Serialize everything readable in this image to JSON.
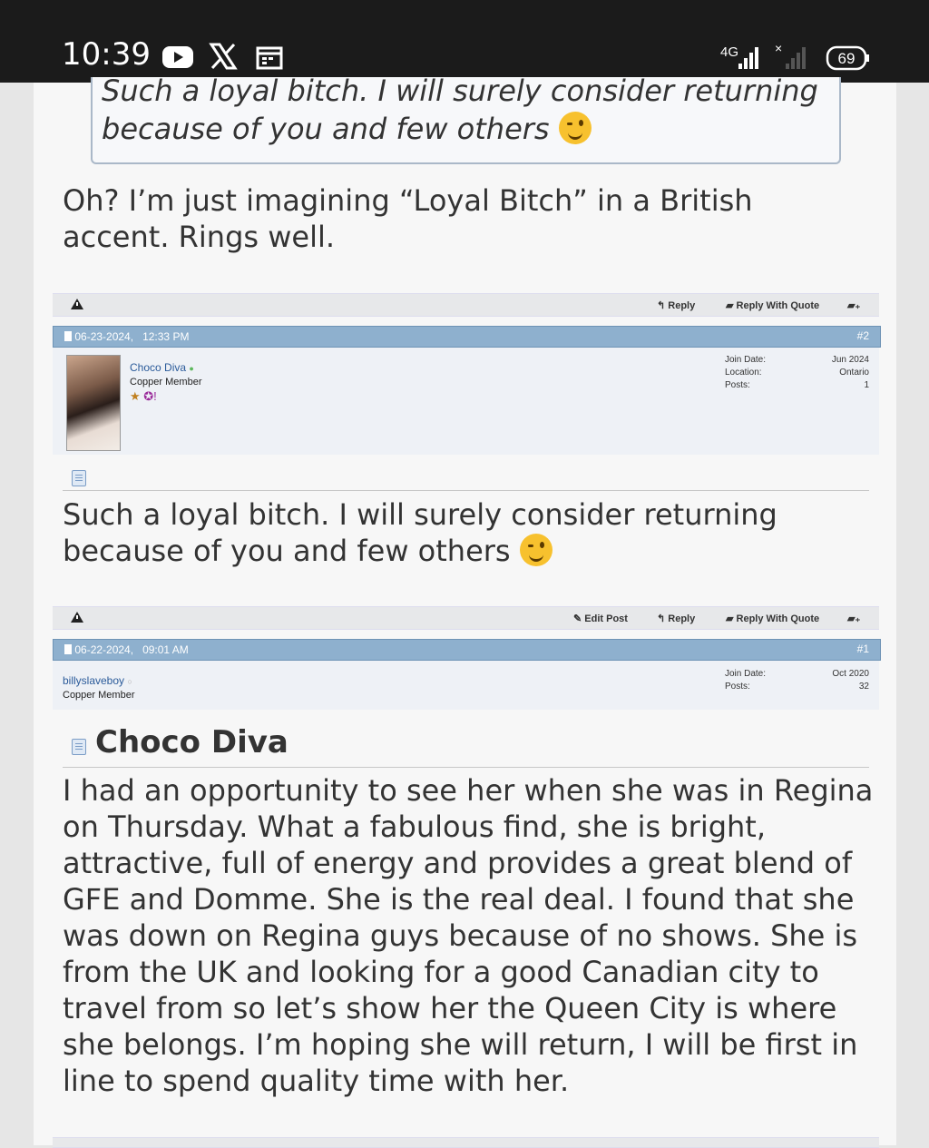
{
  "status_bar": {
    "time": "10:39",
    "network": "4G",
    "battery": "69",
    "icons": [
      "youtube-icon",
      "x-icon",
      "calendar-icon",
      "signal-icon",
      "no-signal-icon",
      "battery-icon"
    ]
  },
  "quoted_post": {
    "quote_text": "Such a loyal bitch. I will surely consider returning because of you and few others",
    "reply_text": "Oh? I’m just imagining “Loyal Bitch” in a British accent. Rings well."
  },
  "toolbar_1": {
    "reply": "Reply",
    "reply_with_quote": "Reply With Quote"
  },
  "post_2": {
    "date": "06-23-2024,",
    "time": "12:33 PM",
    "number": "#2",
    "username": "Choco Diva",
    "user_title": "Copper Member",
    "info": [
      {
        "label": "Join Date:",
        "value": "Jun 2024"
      },
      {
        "label": "Location:",
        "value": "Ontario"
      },
      {
        "label": "Posts:",
        "value": "1"
      }
    ],
    "text": "Such a loyal bitch. I will surely consider returning because of you and few others"
  },
  "toolbar_2": {
    "edit_post": "Edit Post",
    "reply": "Reply",
    "reply_with_quote": "Reply With Quote"
  },
  "post_1": {
    "date": "06-22-2024,",
    "time": "09:01 AM",
    "number": "#1",
    "username": "billyslaveboy",
    "user_title": "Copper Member",
    "info": [
      {
        "label": "Join Date:",
        "value": "Oct 2020"
      },
      {
        "label": "Posts:",
        "value": "32"
      }
    ],
    "title": "Choco Diva",
    "text": "I had an opportunity to see her when she was in Regina on Thursday. What a fabulous find, she is bright, attractive, full of energy and provides a great blend of GFE and Domme. She is the real deal. I found that she was down on Regina guys because of no shows. She is from the UK and looking for a good Canadian city to travel from so let’s show her the Queen City is where she belongs. I’m hoping she will return, I will be first in line to spend quality time with her."
  },
  "colors": {
    "header_blue": "#8eb0ce",
    "username_blue": "#2b5b9a",
    "status_bar": "#1b1b1b"
  }
}
